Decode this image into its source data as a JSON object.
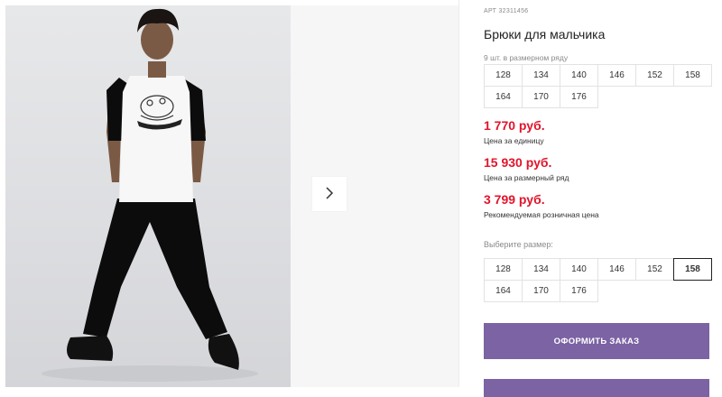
{
  "product": {
    "article": "АРТ 32311456",
    "title": "Брюки для мальчика"
  },
  "size_row": {
    "caption": "9 шт. в размерном ряду",
    "sizes": [
      "128",
      "134",
      "140",
      "146",
      "152",
      "158",
      "164",
      "170",
      "176"
    ]
  },
  "prices": {
    "unit_price": "1 770 руб.",
    "unit_caption": "Цена за единицу",
    "row_price": "15 930 руб.",
    "row_caption": "Цена за размерный ряд",
    "retail_price": "3 799 руб.",
    "retail_caption": "Рекомендуемая розничная цена"
  },
  "size_select": {
    "caption": "Выберите размер:",
    "sizes": [
      "128",
      "134",
      "140",
      "146",
      "152",
      "158",
      "164",
      "170",
      "176"
    ],
    "selected": "158"
  },
  "buttons": {
    "order": "ОФОРМИТЬ ЗАКАЗ"
  },
  "gallery": {
    "photo_subject": "boy in white t-shirt and black pants",
    "next_icon": "chevron-right-icon"
  },
  "colors": {
    "accent": "#7b63a4",
    "price": "#e1142b",
    "selected_border": "#222222"
  }
}
